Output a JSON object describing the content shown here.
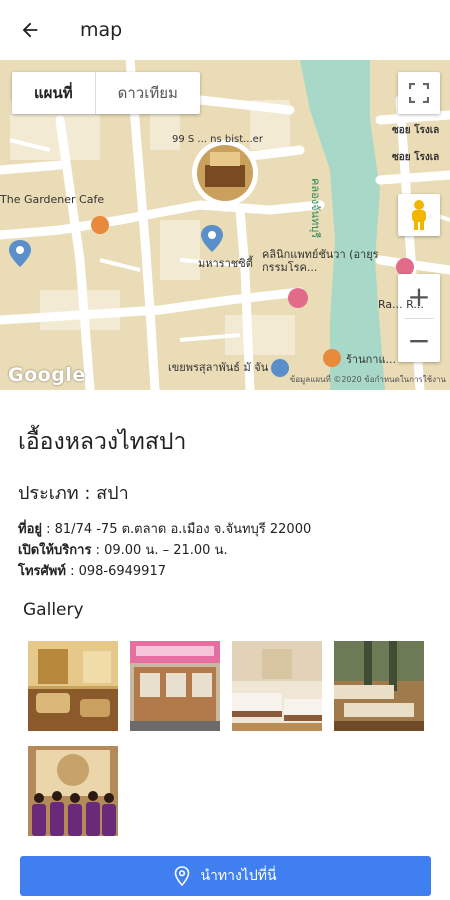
{
  "header": {
    "title": "map"
  },
  "map": {
    "tabs": [
      "แผนที่",
      "ดาวเทียม"
    ],
    "labels": {
      "cafe": "The Gardener Cafe",
      "bistro": "99 S  ...  ns bist...er",
      "maharaj": "มหาราชซิตี้",
      "clinic": "คลินิกแพทย์ชันวา (อายุรกรรมโรค...",
      "canal": "คลองจันทบุรี",
      "soi1": "ซอย โรงเล",
      "soi2": "ซอย โรงเล",
      "ra": "Ra... R...",
      "shop": "ร้านกาแ...",
      "road": "เขยพรสุลาพันธ์ มั จัน",
      "google": "Google",
      "copyright": "ข้อมูลแผนที่ ©2020   ข้อกำหนดในการใช้งาน"
    }
  },
  "place": {
    "name": "เอื้องหลวงไทสปา",
    "type": "ประเภท : สปา",
    "address_label": "ที่อยู่",
    "address_value": " : 81/74 -75 ต.ตลาด อ.เมือง จ.จันทบุรี 22000",
    "hours_label": "เปิดให้บริการ",
    "hours_value": " : 09.00 น. – 21.00 น.",
    "phone_label": "โทรศัพท์",
    "phone_value": " : 098-6949917"
  },
  "gallery": {
    "title": "Gallery"
  },
  "cta": {
    "label": "นำทางไปที่นี่"
  },
  "colors": {
    "accent": "#3f7ff0",
    "map_land": "#e8dcb8",
    "canal": "#a8d8c8"
  }
}
